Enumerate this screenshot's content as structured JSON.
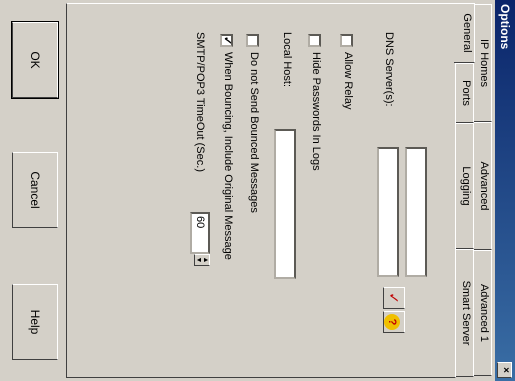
{
  "window": {
    "title": "Options",
    "close_glyph": "×"
  },
  "tabs": {
    "row_back": [
      "IP Homes",
      "Advanced",
      "Advanced 1"
    ],
    "row_front": [
      "General",
      "Ports",
      "Logging",
      "Smart Server"
    ],
    "active": "General"
  },
  "general": {
    "dns_label": "DNS Server(s):",
    "allow_relay": {
      "label": "Allow Relay",
      "checked": false
    },
    "hide_passwords": {
      "label": "Hide Passwords In Logs",
      "checked": false
    },
    "local_host_label": "Local Host:",
    "no_bounce": {
      "label": "Do not Send Bounced Messages",
      "checked": false
    },
    "include_original": {
      "label": "When Bouncing, Include Original Message",
      "checked": true
    },
    "timeout_label": "SMTP/POP3 TimeOut (Sec.)",
    "timeout_value": "60",
    "check_glyph": "✓",
    "help_glyph": "?"
  },
  "buttons": {
    "ok": "OK",
    "cancel": "Cancel",
    "help": "Help"
  },
  "colors": {
    "title_bar": "#0a246a",
    "dialog_bg": "#d4d0c8",
    "check_icon": "#c00000",
    "help_icon": "#f0c000"
  }
}
